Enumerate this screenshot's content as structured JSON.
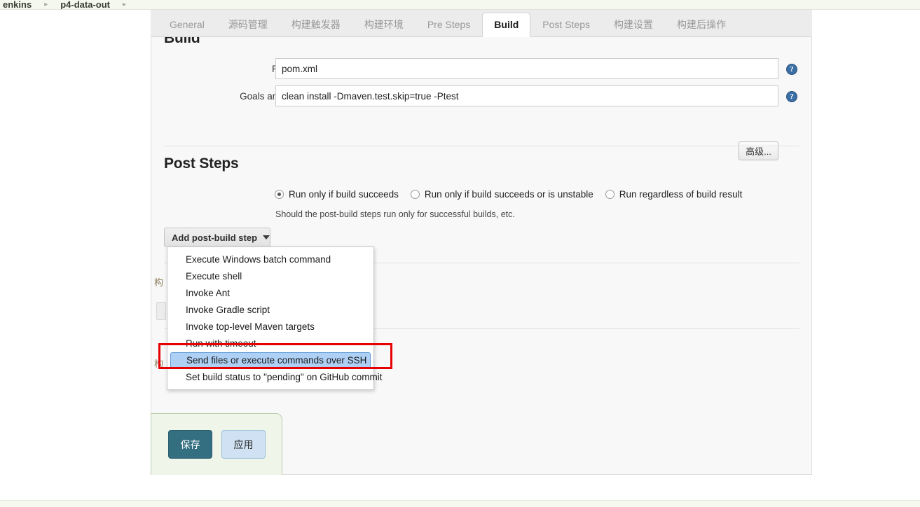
{
  "breadcrumb": {
    "items": [
      "enkins",
      "p4-data-out"
    ],
    "separator": "▸",
    "trailing_separator": "▸"
  },
  "tabs": [
    {
      "label": "General",
      "active": false
    },
    {
      "label": "源码管理",
      "active": false
    },
    {
      "label": "构建触发器",
      "active": false
    },
    {
      "label": "构建环境",
      "active": false
    },
    {
      "label": "Pre Steps",
      "active": false
    },
    {
      "label": "Build",
      "active": true
    },
    {
      "label": "Post Steps",
      "active": false
    },
    {
      "label": "构建设置",
      "active": false
    },
    {
      "label": "构建后操作",
      "active": false
    }
  ],
  "build_section": {
    "title": "Build",
    "fields": [
      {
        "label": "Root POM",
        "value": "pom.xml",
        "help": "?"
      },
      {
        "label": "Goals and options",
        "value": "clean install -Dmaven.test.skip=true -Ptest",
        "help": "?"
      }
    ],
    "advanced_button": "高级..."
  },
  "post_steps_section": {
    "title": "Post Steps",
    "radios": [
      {
        "label": "Run only if build succeeds",
        "checked": true
      },
      {
        "label": "Run only if build succeeds or is unstable",
        "checked": false
      },
      {
        "label": "Run regardless of build result",
        "checked": false
      }
    ],
    "hint": "Should the post-build steps run only for successful builds, etc.",
    "add_step_button": {
      "label": "Add post-build step",
      "caret": "chevron-down-icon"
    }
  },
  "dropdown": {
    "items": [
      {
        "label": "Execute Windows batch command",
        "highlighted": false
      },
      {
        "label": "Execute shell",
        "highlighted": false
      },
      {
        "label": "Invoke Ant",
        "highlighted": false
      },
      {
        "label": "Invoke Gradle script",
        "highlighted": false
      },
      {
        "label": "Invoke top-level Maven targets",
        "highlighted": false
      },
      {
        "label": "Run with timeout",
        "highlighted": false
      },
      {
        "label": "Send files or execute commands over SSH",
        "highlighted": true
      },
      {
        "label": "Set build status to \"pending\" on GitHub commit",
        "highlighted": false
      }
    ],
    "highlight_fill": "#aed0f5",
    "highlight_border": "#5f9ad6"
  },
  "annotation": {
    "color": "#e60000",
    "target": "Send files or execute commands over SSH"
  },
  "save_bar": {
    "save_label": "保存",
    "apply_label": "应用",
    "save_color": "#336e81",
    "apply_color": "#cfe1f2"
  },
  "ghost_fragments": [
    "构",
    "构"
  ]
}
